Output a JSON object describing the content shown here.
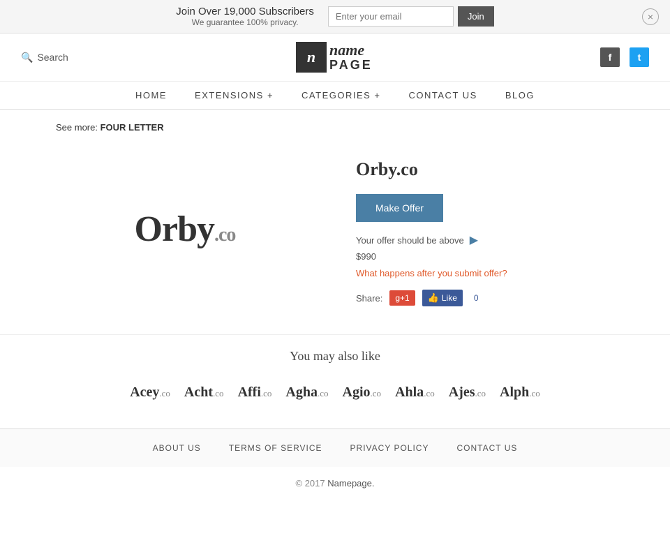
{
  "banner": {
    "headline": "Join Over 19,000 Subscribers",
    "subline": "We guarantee 100% privacy.",
    "email_placeholder": "Enter your email",
    "join_button": "Join",
    "close_label": "×"
  },
  "header": {
    "search_label": "Search",
    "logo_icon": "n",
    "logo_name": "name",
    "logo_page": "PAGE",
    "facebook_icon": "f",
    "twitter_icon": "t"
  },
  "nav": {
    "items": [
      {
        "label": "HOME",
        "id": "home"
      },
      {
        "label": "EXTENSIONS +",
        "id": "extensions"
      },
      {
        "label": "CATEGORIES +",
        "id": "categories"
      },
      {
        "label": "CONTACT US",
        "id": "contact"
      },
      {
        "label": "BLOG",
        "id": "blog"
      }
    ]
  },
  "breadcrumb": {
    "prefix": "See more:",
    "label": "FOUR LETTER"
  },
  "domain": {
    "name": "Orby",
    "tld": ".co",
    "full": "Orby.co",
    "make_offer_label": "Make Offer",
    "offer_info": "Your offer should be above",
    "offer_price": "$990",
    "offer_link": "What happens after you submit offer?",
    "share_label": "Share:",
    "gplus_label": "g+1",
    "fb_label": "Like",
    "fb_count": "0"
  },
  "also_like": {
    "title": "You may also like",
    "domains": [
      {
        "name": "Acey",
        "tld": ".co"
      },
      {
        "name": "Acht",
        "tld": ".co"
      },
      {
        "name": "Affi",
        "tld": ".co"
      },
      {
        "name": "Agha",
        "tld": ".co"
      },
      {
        "name": "Agio",
        "tld": ".co"
      },
      {
        "name": "Ahla",
        "tld": ".co"
      },
      {
        "name": "Ajes",
        "tld": ".co"
      },
      {
        "name": "Alph",
        "tld": ".co"
      }
    ]
  },
  "footer": {
    "links": [
      {
        "label": "ABOUT US",
        "id": "about"
      },
      {
        "label": "TERMS OF SERVICE",
        "id": "terms"
      },
      {
        "label": "PRIVACY POLICY",
        "id": "privacy"
      },
      {
        "label": "CONTACT US",
        "id": "contact"
      }
    ],
    "copyright": "© 2017",
    "copyright_link": "Namepage."
  }
}
